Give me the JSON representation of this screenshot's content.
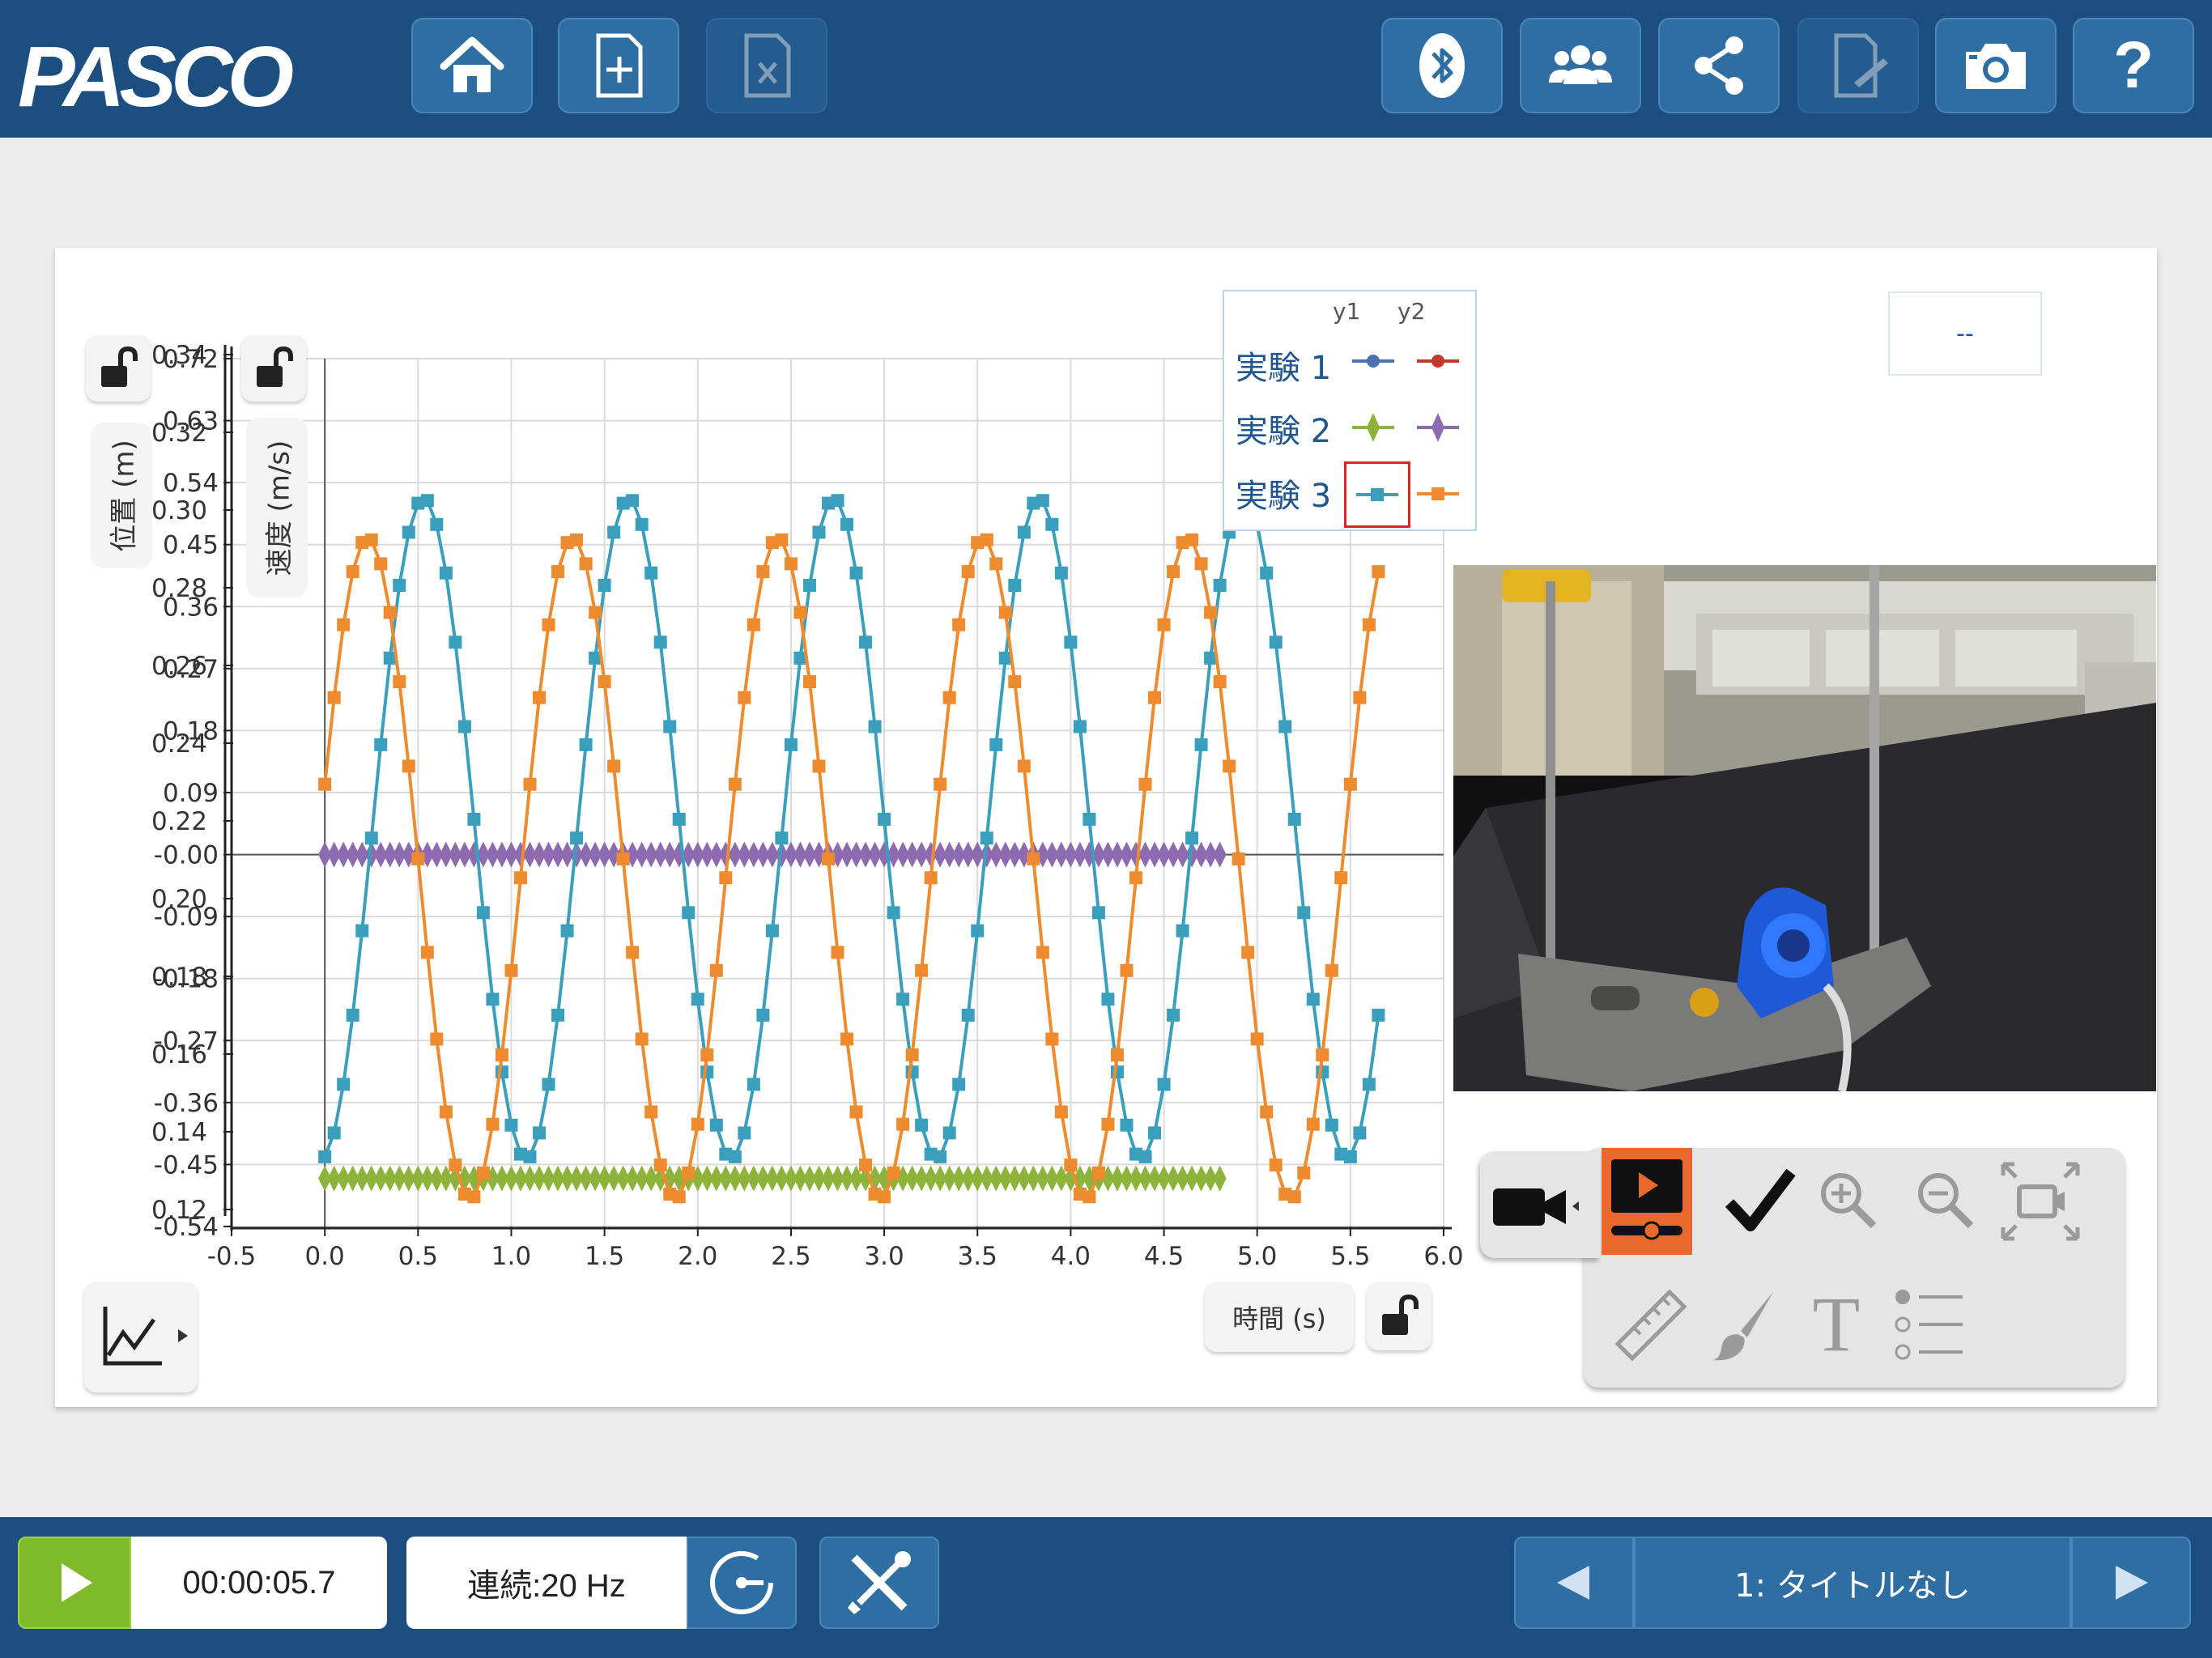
{
  "app": {
    "logo": "PASCO"
  },
  "toolbar": {
    "buttons": [
      {
        "name": "home",
        "icon": "home-icon",
        "enabled": true
      },
      {
        "name": "new-file",
        "icon": "new-file-icon",
        "enabled": true
      },
      {
        "name": "close-file",
        "icon": "close-file-icon",
        "enabled": false
      },
      {
        "name": "bluetooth",
        "icon": "bluetooth-icon",
        "enabled": true
      },
      {
        "name": "users",
        "icon": "users-icon",
        "enabled": true
      },
      {
        "name": "share",
        "icon": "share-icon",
        "enabled": true
      },
      {
        "name": "journal",
        "icon": "journal-icon",
        "enabled": false
      },
      {
        "name": "camera",
        "icon": "camera-icon",
        "enabled": true
      },
      {
        "name": "help",
        "icon": "help-icon",
        "enabled": true
      }
    ],
    "help_label": "?"
  },
  "graph": {
    "y1_axis_label": "位置 (m)",
    "y2_axis_label": "速度 (m/s)",
    "x_axis_label": "時間 (s)",
    "value_box": "--",
    "legend": {
      "col_y1": "y1",
      "col_y2": "y2",
      "runs": [
        {
          "name": "実験 1",
          "y1_color": "#4a72b0",
          "y2_color": "#c0392b",
          "marker": "circle"
        },
        {
          "name": "実験 2",
          "y1_color": "#8db33a",
          "y2_color": "#8e6bb0",
          "marker": "diamond"
        },
        {
          "name": "実験 3",
          "y1_color": "#3a9fbd",
          "y2_color": "#ee8b2f",
          "marker": "square",
          "highlighted": "y1"
        }
      ]
    }
  },
  "chart_data": {
    "type": "scatter",
    "xlabel": "時間 (s)",
    "ylabel": "位置 (m)",
    "y2label": "速度 (m/s)",
    "xlim": [
      -0.5,
      6.0
    ],
    "xticks": [
      "-0.5",
      "0.0",
      "0.5",
      "1.0",
      "1.5",
      "2.0",
      "2.5",
      "3.0",
      "3.5",
      "4.0",
      "4.5",
      "5.0",
      "5.5",
      "6.0"
    ],
    "ylim": [
      0.12,
      0.34
    ],
    "yticks": [
      "0.12",
      "0.14",
      "0.16",
      "0.18",
      "0.20",
      "0.22",
      "0.24",
      "0.26",
      "0.28",
      "0.30",
      "0.32",
      "0.34"
    ],
    "y2lim": [
      -0.54,
      0.72
    ],
    "y2ticks": [
      "-0.54",
      "-0.45",
      "-0.36",
      "-0.27",
      "-0.18",
      "-0.09",
      "-0.00",
      "0.09",
      "0.18",
      "0.27",
      "0.36",
      "0.45",
      "0.54",
      "0.63",
      "0.72"
    ],
    "grid": true,
    "legend_position": "top-right",
    "series": [
      {
        "name": "実験 2",
        "axis": "y1",
        "color": "#8db33a",
        "marker": "diamond",
        "model": {
          "kind": "constant",
          "value": 0.128,
          "t0": 0.0,
          "t1": 4.8,
          "dt": 0.05
        }
      },
      {
        "name": "実験 2",
        "axis": "y2",
        "color": "#8e6bb0",
        "marker": "diamond",
        "model": {
          "kind": "constant",
          "value": 0.0,
          "t0": 0.0,
          "t1": 4.8,
          "dt": 0.05
        }
      },
      {
        "name": "実験 3",
        "axis": "y1",
        "color": "#3a9fbd",
        "marker": "square",
        "model": {
          "kind": "sine",
          "center": 0.218,
          "amplitude": 0.085,
          "period": 1.1,
          "peak_time": 0.53,
          "t0": 0.0,
          "t1": 5.65,
          "dt": 0.05
        }
      },
      {
        "name": "実験 3",
        "axis": "y2",
        "color": "#ee8b2f",
        "marker": "square",
        "model": {
          "kind": "sine",
          "center": -0.02,
          "amplitude": 0.48,
          "period": 1.1,
          "peak_time": 0.23,
          "t0": 0.0,
          "t1": 5.65,
          "dt": 0.05
        }
      }
    ]
  },
  "video": {
    "tools_row1": [
      "video-camera-icon",
      "playback-icon",
      "checkmark-icon",
      "zoom-in-icon",
      "zoom-out-icon",
      "fit-frame-icon"
    ],
    "tools_row2": [
      "ruler-icon",
      "brush-icon",
      "text-tool-icon",
      "list-icon"
    ],
    "text_tool_glyph": "T",
    "active_color": "#e8692b"
  },
  "bottom": {
    "time": "00:00:05.7",
    "mode": "連続:20 Hz",
    "page_title": "1: タイトルなし",
    "play_color": "#7fba2a"
  }
}
